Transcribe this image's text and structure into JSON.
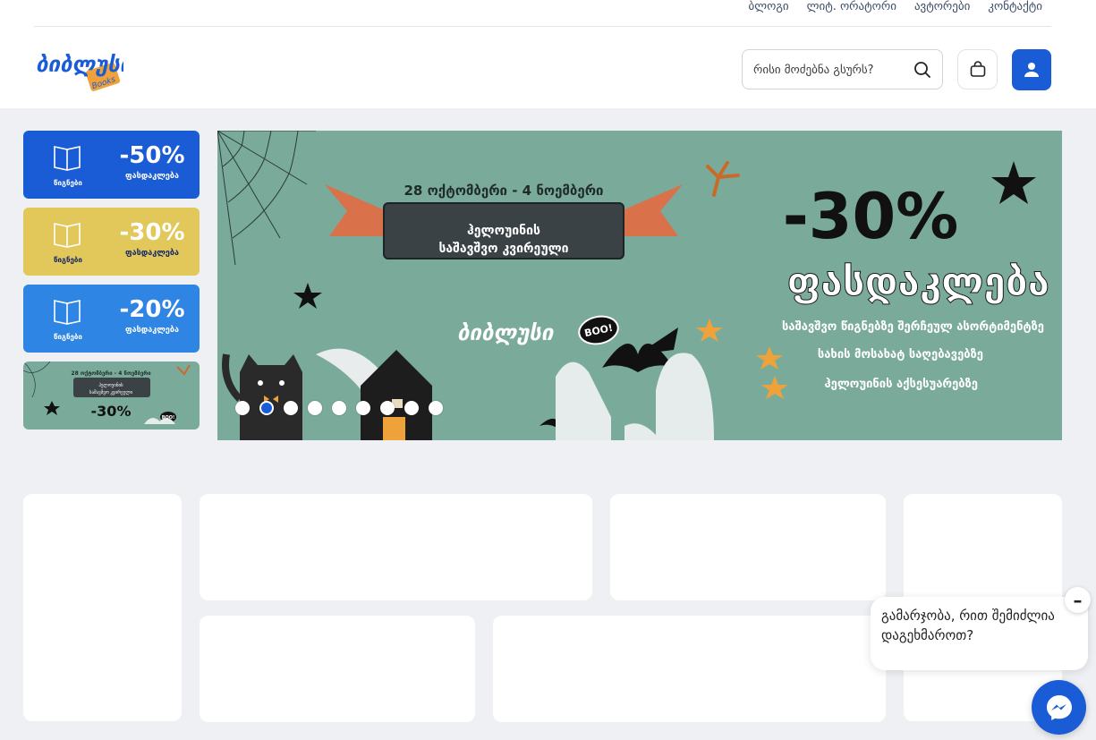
{
  "topnav": {
    "links": [
      "ბლოგი",
      "ლიტ. ორატორი",
      "ავტორები",
      "კონტაქტი"
    ]
  },
  "brand": {
    "logo_text": "ბიბლუსი",
    "logo_sub": "Books",
    "primary_color": "#1a5bd6"
  },
  "search": {
    "placeholder": "რისი მოძებნა გსურს?",
    "value": "",
    "icon": "search-icon"
  },
  "header_buttons": {
    "cart_icon": "cart-icon",
    "user_icon": "user-icon"
  },
  "promos": [
    {
      "percent": "-50%",
      "label": "ფასდაკლება",
      "category": "წიგნები",
      "color": "#1a5bd6"
    },
    {
      "percent": "-30%",
      "label": "ფასდაკლება",
      "category": "წიგნები",
      "color": "#e2c75a"
    },
    {
      "percent": "-20%",
      "label": "ფასდაკლება",
      "category": "წიგნები",
      "color": "#2f85e3"
    }
  ],
  "mini_banner": {
    "date": "28 ოქტომბერი - 4 ნოემბერი",
    "title1": "ჰელოუინის",
    "title2": "საშავშვო კვირეული",
    "percent": "-30%",
    "boo": "BOO!"
  },
  "hero": {
    "date_range": "28 ოქტომბერი - 4 ნოემბერი",
    "event_line1": "ჰელოუინის",
    "event_line2": "საშავშვო კვირეული",
    "percent": "-30%",
    "discount_word": "ფასდაკლება",
    "features": [
      "საშავშვო წიგნებზე შერჩეულ ასორტიმენტზე",
      "სახის მოსახატ საღებავებზე",
      "ჰელოუინის აქსესუარებზე"
    ],
    "logo_text": "ბიბლუსი",
    "boo": "BOO!",
    "bg_color": "#7aab9a"
  },
  "carousel": {
    "slides": 9,
    "active_index": 1
  },
  "chat": {
    "greeting": "გამარჯობა, რით შემიძლია დაგეხმაროთ?",
    "close_symbol": "–",
    "icon": "messenger-icon"
  }
}
